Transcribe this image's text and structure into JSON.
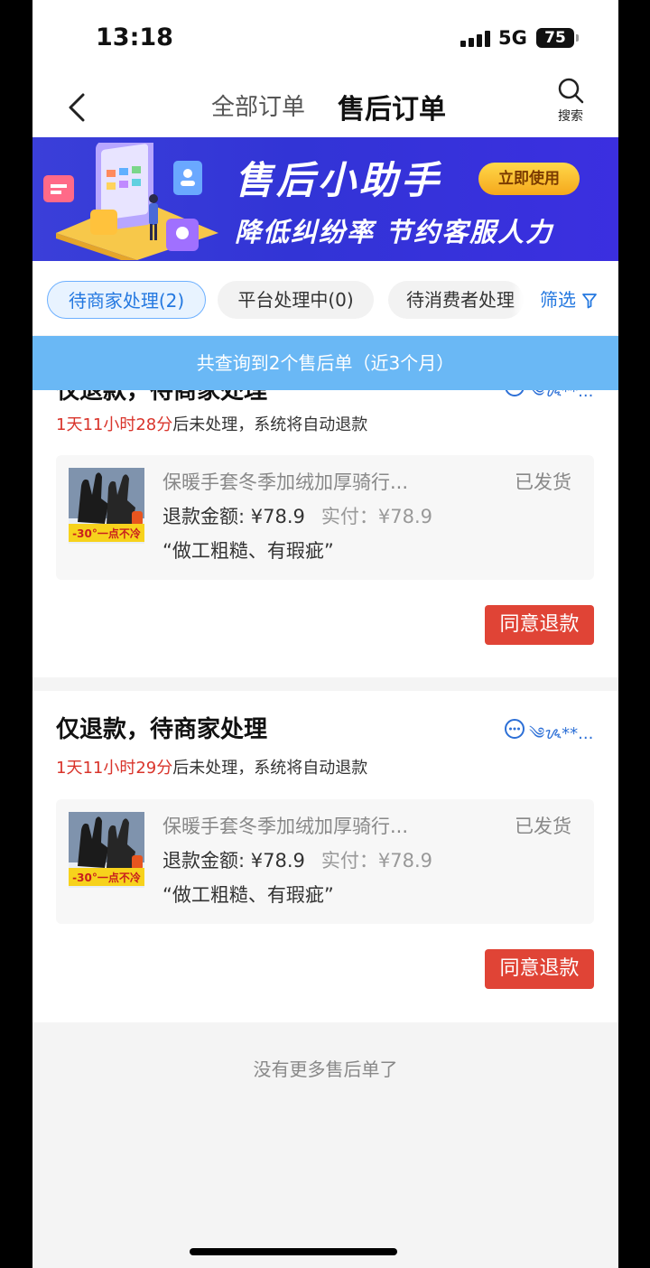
{
  "status_bar": {
    "time": "13:18",
    "network": "5G",
    "battery": "75"
  },
  "nav": {
    "tab_all": "全部订单",
    "tab_after_sale": "售后订单",
    "search_label": "搜索"
  },
  "banner": {
    "title": "售后小助手",
    "subtitle": "降低纠纷率 节约客服人力",
    "button": "立即使用"
  },
  "filters": {
    "chips": [
      "待商家处理(2)",
      "平台处理中(0)",
      "待消费者处理"
    ],
    "filter_label": "筛选"
  },
  "result_text": "共查询到2个售后单（近3个月）",
  "orders": [
    {
      "title": "仅退款，待商家处理",
      "user": "༄ᝰ**...",
      "timer_red": "1天11小时28分",
      "timer_rest": "后未处理，系统将自动退款",
      "product_name": "保暖手套冬季加绒加厚骑行...",
      "status": "已发货",
      "refund": "退款金额: ¥78.9",
      "paid": "实付：¥78.9",
      "reason": "“做工粗糙、有瑕疵”",
      "image_text": "-30°一点不冷",
      "button": "同意退款"
    },
    {
      "title": "仅退款，待商家处理",
      "user": "༄ᝰ**...",
      "timer_red": "1天11小时29分",
      "timer_rest": "后未处理，系统将自动退款",
      "product_name": "保暖手套冬季加绒加厚骑行...",
      "status": "已发货",
      "refund": "退款金额: ¥78.9",
      "paid": "实付：¥78.9",
      "reason": "“做工粗糙、有瑕疵”",
      "image_text": "-30°一点不冷",
      "button": "同意退款"
    }
  ],
  "footer_text": "没有更多售后单了",
  "colors": {
    "accent": "#2478e0",
    "danger": "#e04436",
    "banner": "#3234d6",
    "result_bar": "#6ab8f5"
  }
}
